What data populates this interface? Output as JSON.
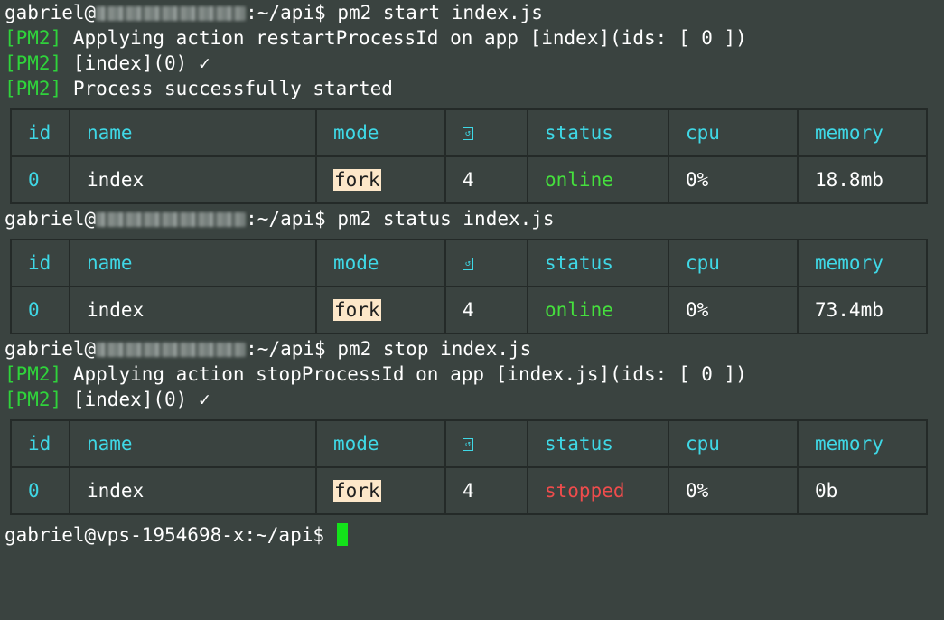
{
  "session_1": {
    "prompt_user": "gabriel@",
    "prompt_path": ":~/api$",
    "command": "pm2 start index.js",
    "outputs": [
      {
        "tag": "[PM2]",
        "text": "Applying action restartProcessId on app [index](ids: [ 0 ])"
      },
      {
        "tag": "[PM2]",
        "text": "[index](0) ✓"
      },
      {
        "tag": "[PM2]",
        "text": "Process successfully started"
      }
    ],
    "table": {
      "headers": [
        "id",
        "name",
        "mode",
        "↺",
        "status",
        "cpu",
        "memory"
      ],
      "row": {
        "id": "0",
        "name": "index",
        "mode": "fork",
        "restarts": "4",
        "status": "online",
        "cpu": "0%",
        "memory": "18.8mb"
      }
    }
  },
  "session_2": {
    "prompt_user": "gabriel@",
    "prompt_path": ":~/api$",
    "command": "pm2 status index.js",
    "table": {
      "headers": [
        "id",
        "name",
        "mode",
        "↺",
        "status",
        "cpu",
        "memory"
      ],
      "row": {
        "id": "0",
        "name": "index",
        "mode": "fork",
        "restarts": "4",
        "status": "online",
        "cpu": "0%",
        "memory": "73.4mb"
      }
    }
  },
  "session_3": {
    "prompt_user": "gabriel@",
    "prompt_path": ":~/api$",
    "command": "pm2 stop index.js",
    "outputs": [
      {
        "tag": "[PM2]",
        "text": "Applying action stopProcessId on app [index.js](ids: [ 0 ])"
      },
      {
        "tag": "[PM2]",
        "text": "[index](0) ✓"
      }
    ],
    "table": {
      "headers": [
        "id",
        "name",
        "mode",
        "↺",
        "status",
        "cpu",
        "memory"
      ],
      "row": {
        "id": "0",
        "name": "index",
        "mode": "fork",
        "restarts": "4",
        "status": "stopped",
        "cpu": "0%",
        "memory": "0b"
      }
    }
  },
  "final_prompt": {
    "text": "gabriel@vps-1954698-x:~/api$"
  },
  "colors": {
    "background": "#3a4340",
    "pm2_tag": "#2fd33b",
    "header_cyan": "#3fd8e6",
    "online": "#45df3d",
    "stopped": "#ef4c4c",
    "fork_bg": "#fde7c9",
    "cursor": "#13e21a"
  },
  "icons": {
    "restart_column": "restart-glyph-icon",
    "check": "checkmark-icon",
    "cursor": "terminal-cursor"
  }
}
